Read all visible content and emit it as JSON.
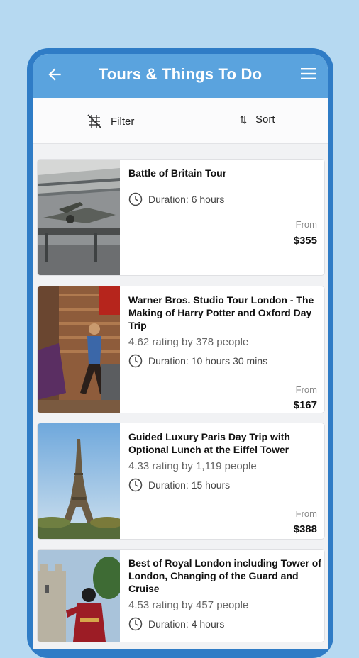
{
  "header": {
    "title": "Tours & Things To Do"
  },
  "toolbar": {
    "filter_label": "Filter",
    "sort_label": "Sort"
  },
  "tours": [
    {
      "title": "Battle of Britain Tour",
      "rating": "",
      "duration": "Duration: 6 hours",
      "from_label": "From",
      "price": "$355"
    },
    {
      "title": "Warner Bros. Studio Tour London - The Making of Harry Potter and Oxford Day Trip",
      "rating": "4.62 rating by 378 people",
      "duration": "Duration: 10 hours 30 mins",
      "from_label": "From",
      "price": "$167"
    },
    {
      "title": "Guided Luxury Paris Day Trip with Optional Lunch at the Eiffel Tower",
      "rating": "4.33 rating by 1,119 people",
      "duration": "Duration: 15 hours",
      "from_label": "From",
      "price": "$388"
    },
    {
      "title": "Best of Royal London including Tower of London, Changing of the Guard and Cruise",
      "rating": "4.53 rating by 457 people",
      "duration": "Duration: 4 hours",
      "from_label": "",
      "price": ""
    }
  ],
  "colors": {
    "appbar": "#5aa3de",
    "phone_frame": "#2f7cc6",
    "background": "#b6d9f1"
  },
  "icons": [
    "back-arrow-icon",
    "menu-icon",
    "filter-icon",
    "sort-icon",
    "clock-icon"
  ]
}
